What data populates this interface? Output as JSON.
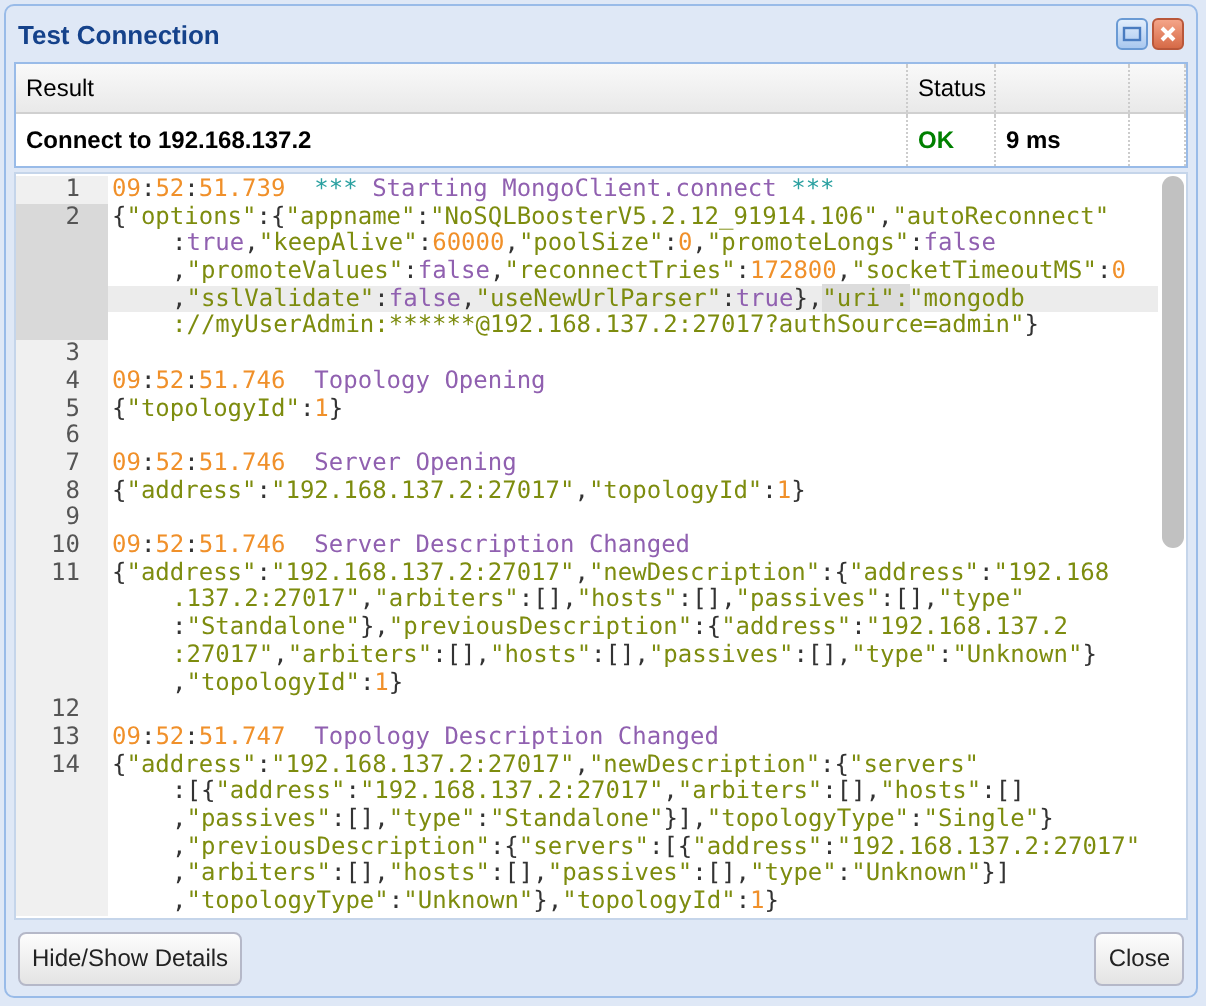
{
  "window": {
    "title": "Test Connection"
  },
  "results": {
    "columns": [
      "Result",
      "Status"
    ],
    "rows": [
      {
        "result": "Connect to 192.168.137.2",
        "status": "OK",
        "time": "9 ms"
      }
    ]
  },
  "log": {
    "lines": [
      {
        "number": "1",
        "selected": false,
        "wraps": [
          {
            "active": false,
            "tokens": [
              {
                "kind": "n",
                "text": "09"
              },
              {
                "kind": "p",
                "text": ":"
              },
              {
                "kind": "n",
                "text": "52"
              },
              {
                "kind": "p",
                "text": ":"
              },
              {
                "kind": "t",
                "text": "51.739"
              },
              {
                "kind": "m",
                "text": "***"
              },
              {
                "kind": "e",
                "text": " Starting MongoClient.connect "
              },
              {
                "kind": "m",
                "text": "***"
              }
            ]
          }
        ]
      },
      {
        "number": "2",
        "selected": true,
        "wraps": [
          {
            "active": false,
            "tokens": [
              {
                "kind": "p",
                "text": "{"
              },
              {
                "kind": "s",
                "text": "\"options\""
              },
              {
                "kind": "p",
                "text": ":{"
              },
              {
                "kind": "s",
                "text": "\"appname\""
              },
              {
                "kind": "p",
                "text": ":"
              },
              {
                "kind": "s",
                "text": "\"NoSQLBoosterV5.2.12_91914.106\""
              },
              {
                "kind": "p",
                "text": ","
              },
              {
                "kind": "s",
                "text": "\"autoReconnect\""
              }
            ]
          },
          {
            "active": false,
            "tokens": [
              {
                "kind": "p",
                "text": ":"
              },
              {
                "kind": "k",
                "text": "true"
              },
              {
                "kind": "p",
                "text": ","
              },
              {
                "kind": "s",
                "text": "\"keepAlive\""
              },
              {
                "kind": "p",
                "text": ":"
              },
              {
                "kind": "n",
                "text": "60000"
              },
              {
                "kind": "p",
                "text": ","
              },
              {
                "kind": "s",
                "text": "\"poolSize\""
              },
              {
                "kind": "p",
                "text": ":"
              },
              {
                "kind": "n",
                "text": "0"
              },
              {
                "kind": "p",
                "text": ","
              },
              {
                "kind": "s",
                "text": "\"promoteLongs\""
              },
              {
                "kind": "p",
                "text": ":"
              },
              {
                "kind": "k",
                "text": "false"
              }
            ]
          },
          {
            "active": false,
            "tokens": [
              {
                "kind": "p",
                "text": ","
              },
              {
                "kind": "s",
                "text": "\"promoteValues\""
              },
              {
                "kind": "p",
                "text": ":"
              },
              {
                "kind": "k",
                "text": "false"
              },
              {
                "kind": "p",
                "text": ","
              },
              {
                "kind": "s",
                "text": "\"reconnectTries\""
              },
              {
                "kind": "p",
                "text": ":"
              },
              {
                "kind": "n",
                "text": "172800"
              },
              {
                "kind": "p",
                "text": ","
              },
              {
                "kind": "s",
                "text": "\"socketTimeoutMS\""
              },
              {
                "kind": "p",
                "text": ":"
              },
              {
                "kind": "n",
                "text": "0"
              }
            ]
          },
          {
            "active": true,
            "tokens": [
              {
                "kind": "p",
                "text": ","
              },
              {
                "kind": "s",
                "text": "\"sslValidate\""
              },
              {
                "kind": "p",
                "text": ":"
              },
              {
                "kind": "k",
                "text": "false"
              },
              {
                "kind": "p",
                "text": ","
              },
              {
                "kind": "s",
                "text": "\"useNewUrlParser\""
              },
              {
                "kind": "p",
                "text": ":"
              },
              {
                "kind": "k",
                "text": "true"
              },
              {
                "kind": "p",
                "text": "},"
              },
              {
                "kind": "h",
                "text": "\"uri\":"
              },
              {
                "kind": "s",
                "text": "\"mongodb"
              }
            ]
          },
          {
            "active": false,
            "tokens": [
              {
                "kind": "s",
                "text": "://myUserAdmin:******@192.168.137.2:27017?authSource=admin\""
              },
              {
                "kind": "p",
                "text": "}"
              }
            ]
          }
        ]
      },
      {
        "number": "3",
        "selected": false
      },
      {
        "number": "4",
        "selected": false,
        "wraps": [
          {
            "active": false,
            "tokens": [
              {
                "kind": "n",
                "text": "09"
              },
              {
                "kind": "p",
                "text": ":"
              },
              {
                "kind": "n",
                "text": "52"
              },
              {
                "kind": "p",
                "text": ":"
              },
              {
                "kind": "t",
                "text": "51.746"
              },
              {
                "kind": "e",
                "text": "Topology Opening"
              }
            ]
          }
        ]
      },
      {
        "number": "5",
        "selected": false,
        "wraps": [
          {
            "active": false,
            "tokens": [
              {
                "kind": "p",
                "text": "{"
              },
              {
                "kind": "s",
                "text": "\"topologyId\""
              },
              {
                "kind": "p",
                "text": ":"
              },
              {
                "kind": "n",
                "text": "1"
              },
              {
                "kind": "p",
                "text": "}"
              }
            ]
          }
        ]
      },
      {
        "number": "6",
        "selected": false
      },
      {
        "number": "7",
        "selected": false,
        "wraps": [
          {
            "active": false,
            "tokens": [
              {
                "kind": "n",
                "text": "09"
              },
              {
                "kind": "p",
                "text": ":"
              },
              {
                "kind": "n",
                "text": "52"
              },
              {
                "kind": "p",
                "text": ":"
              },
              {
                "kind": "t",
                "text": "51.746"
              },
              {
                "kind": "e",
                "text": "Server Opening"
              }
            ]
          }
        ]
      },
      {
        "number": "8",
        "selected": false,
        "wraps": [
          {
            "active": false,
            "tokens": [
              {
                "kind": "p",
                "text": "{"
              },
              {
                "kind": "s",
                "text": "\"address\""
              },
              {
                "kind": "p",
                "text": ":"
              },
              {
                "kind": "s",
                "text": "\"192.168.137.2:27017\""
              },
              {
                "kind": "p",
                "text": ","
              },
              {
                "kind": "s",
                "text": "\"topologyId\""
              },
              {
                "kind": "p",
                "text": ":"
              },
              {
                "kind": "n",
                "text": "1"
              },
              {
                "kind": "p",
                "text": "}"
              }
            ]
          }
        ]
      },
      {
        "number": "9",
        "selected": false
      },
      {
        "number": "10",
        "selected": false,
        "wraps": [
          {
            "active": false,
            "tokens": [
              {
                "kind": "n",
                "text": "09"
              },
              {
                "kind": "p",
                "text": ":"
              },
              {
                "kind": "n",
                "text": "52"
              },
              {
                "kind": "p",
                "text": ":"
              },
              {
                "kind": "t",
                "text": "51.746"
              },
              {
                "kind": "e",
                "text": "Server Description Changed"
              }
            ]
          }
        ]
      },
      {
        "number": "11",
        "selected": false,
        "wraps": [
          {
            "active": false,
            "tokens": [
              {
                "kind": "p",
                "text": "{"
              },
              {
                "kind": "s",
                "text": "\"address\""
              },
              {
                "kind": "p",
                "text": ":"
              },
              {
                "kind": "s",
                "text": "\"192.168.137.2:27017\""
              },
              {
                "kind": "p",
                "text": ","
              },
              {
                "kind": "s",
                "text": "\"newDescription\""
              },
              {
                "kind": "p",
                "text": ":{"
              },
              {
                "kind": "s",
                "text": "\"address\""
              },
              {
                "kind": "p",
                "text": ":"
              },
              {
                "kind": "s",
                "text": "\"192.168"
              }
            ]
          },
          {
            "active": false,
            "tokens": [
              {
                "kind": "s",
                "text": ".137.2:27017\""
              },
              {
                "kind": "p",
                "text": ","
              },
              {
                "kind": "s",
                "text": "\"arbiters\""
              },
              {
                "kind": "p",
                "text": ":[],"
              },
              {
                "kind": "s",
                "text": "\"hosts\""
              },
              {
                "kind": "p",
                "text": ":[],"
              },
              {
                "kind": "s",
                "text": "\"passives\""
              },
              {
                "kind": "p",
                "text": ":[],"
              },
              {
                "kind": "s",
                "text": "\"type\""
              }
            ]
          },
          {
            "active": false,
            "tokens": [
              {
                "kind": "p",
                "text": ":"
              },
              {
                "kind": "s",
                "text": "\"Standalone\""
              },
              {
                "kind": "p",
                "text": "},"
              },
              {
                "kind": "s",
                "text": "\"previousDescription\""
              },
              {
                "kind": "p",
                "text": ":{"
              },
              {
                "kind": "s",
                "text": "\"address\""
              },
              {
                "kind": "p",
                "text": ":"
              },
              {
                "kind": "s",
                "text": "\"192.168.137.2"
              }
            ]
          },
          {
            "active": false,
            "tokens": [
              {
                "kind": "s",
                "text": ":27017\""
              },
              {
                "kind": "p",
                "text": ","
              },
              {
                "kind": "s",
                "text": "\"arbiters\""
              },
              {
                "kind": "p",
                "text": ":[],"
              },
              {
                "kind": "s",
                "text": "\"hosts\""
              },
              {
                "kind": "p",
                "text": ":[],"
              },
              {
                "kind": "s",
                "text": "\"passives\""
              },
              {
                "kind": "p",
                "text": ":[],"
              },
              {
                "kind": "s",
                "text": "\"type\""
              },
              {
                "kind": "p",
                "text": ":"
              },
              {
                "kind": "s",
                "text": "\"Unknown\""
              },
              {
                "kind": "p",
                "text": "}"
              }
            ]
          },
          {
            "active": false,
            "tokens": [
              {
                "kind": "p",
                "text": ","
              },
              {
                "kind": "s",
                "text": "\"topologyId\""
              },
              {
                "kind": "p",
                "text": ":"
              },
              {
                "kind": "n",
                "text": "1"
              },
              {
                "kind": "p",
                "text": "}"
              }
            ]
          }
        ]
      },
      {
        "number": "12",
        "selected": false
      },
      {
        "number": "13",
        "selected": false,
        "wraps": [
          {
            "active": false,
            "tokens": [
              {
                "kind": "n",
                "text": "09"
              },
              {
                "kind": "p",
                "text": ":"
              },
              {
                "kind": "n",
                "text": "52"
              },
              {
                "kind": "p",
                "text": ":"
              },
              {
                "kind": "t",
                "text": "51.747"
              },
              {
                "kind": "e",
                "text": "Topology Description Changed"
              }
            ]
          }
        ]
      },
      {
        "number": "14",
        "selected": false,
        "wraps": [
          {
            "active": false,
            "tokens": [
              {
                "kind": "p",
                "text": "{"
              },
              {
                "kind": "s",
                "text": "\"address\""
              },
              {
                "kind": "p",
                "text": ":"
              },
              {
                "kind": "s",
                "text": "\"192.168.137.2:27017\""
              },
              {
                "kind": "p",
                "text": ","
              },
              {
                "kind": "s",
                "text": "\"newDescription\""
              },
              {
                "kind": "p",
                "text": ":{"
              },
              {
                "kind": "s",
                "text": "\"servers\""
              }
            ]
          },
          {
            "active": false,
            "tokens": [
              {
                "kind": "p",
                "text": ":[{"
              },
              {
                "kind": "s",
                "text": "\"address\""
              },
              {
                "kind": "p",
                "text": ":"
              },
              {
                "kind": "s",
                "text": "\"192.168.137.2:27017\""
              },
              {
                "kind": "p",
                "text": ","
              },
              {
                "kind": "s",
                "text": "\"arbiters\""
              },
              {
                "kind": "p",
                "text": ":[],"
              },
              {
                "kind": "s",
                "text": "\"hosts\""
              },
              {
                "kind": "p",
                "text": ":[]"
              }
            ]
          },
          {
            "active": false,
            "tokens": [
              {
                "kind": "p",
                "text": ","
              },
              {
                "kind": "s",
                "text": "\"passives\""
              },
              {
                "kind": "p",
                "text": ":[],"
              },
              {
                "kind": "s",
                "text": "\"type\""
              },
              {
                "kind": "p",
                "text": ":"
              },
              {
                "kind": "s",
                "text": "\"Standalone\""
              },
              {
                "kind": "p",
                "text": "}],"
              },
              {
                "kind": "s",
                "text": "\"topologyType\""
              },
              {
                "kind": "p",
                "text": ":"
              },
              {
                "kind": "s",
                "text": "\"Single\""
              },
              {
                "kind": "p",
                "text": "}"
              }
            ]
          },
          {
            "active": false,
            "tokens": [
              {
                "kind": "p",
                "text": ","
              },
              {
                "kind": "s",
                "text": "\"previousDescription\""
              },
              {
                "kind": "p",
                "text": ":{"
              },
              {
                "kind": "s",
                "text": "\"servers\""
              },
              {
                "kind": "p",
                "text": ":[{"
              },
              {
                "kind": "s",
                "text": "\"address\""
              },
              {
                "kind": "p",
                "text": ":"
              },
              {
                "kind": "s",
                "text": "\"192.168.137.2:27017\""
              }
            ]
          },
          {
            "active": false,
            "tokens": [
              {
                "kind": "p",
                "text": ","
              },
              {
                "kind": "s",
                "text": "\"arbiters\""
              },
              {
                "kind": "p",
                "text": ":[],"
              },
              {
                "kind": "s",
                "text": "\"hosts\""
              },
              {
                "kind": "p",
                "text": ":[],"
              },
              {
                "kind": "s",
                "text": "\"passives\""
              },
              {
                "kind": "p",
                "text": ":[],"
              },
              {
                "kind": "s",
                "text": "\"type\""
              },
              {
                "kind": "p",
                "text": ":"
              },
              {
                "kind": "s",
                "text": "\"Unknown\""
              },
              {
                "kind": "p",
                "text": "}]"
              }
            ]
          },
          {
            "active": false,
            "tokens": [
              {
                "kind": "p",
                "text": ","
              },
              {
                "kind": "s",
                "text": "\"topologyType\""
              },
              {
                "kind": "p",
                "text": ":"
              },
              {
                "kind": "s",
                "text": "\"Unknown\""
              },
              {
                "kind": "p",
                "text": "},"
              },
              {
                "kind": "s",
                "text": "\"topologyId\""
              },
              {
                "kind": "p",
                "text": ":"
              },
              {
                "kind": "n",
                "text": "1"
              },
              {
                "kind": "p",
                "text": "}"
              }
            ]
          }
        ]
      }
    ]
  },
  "buttons": {
    "left": "Hide/Show Details",
    "right": "Close"
  }
}
